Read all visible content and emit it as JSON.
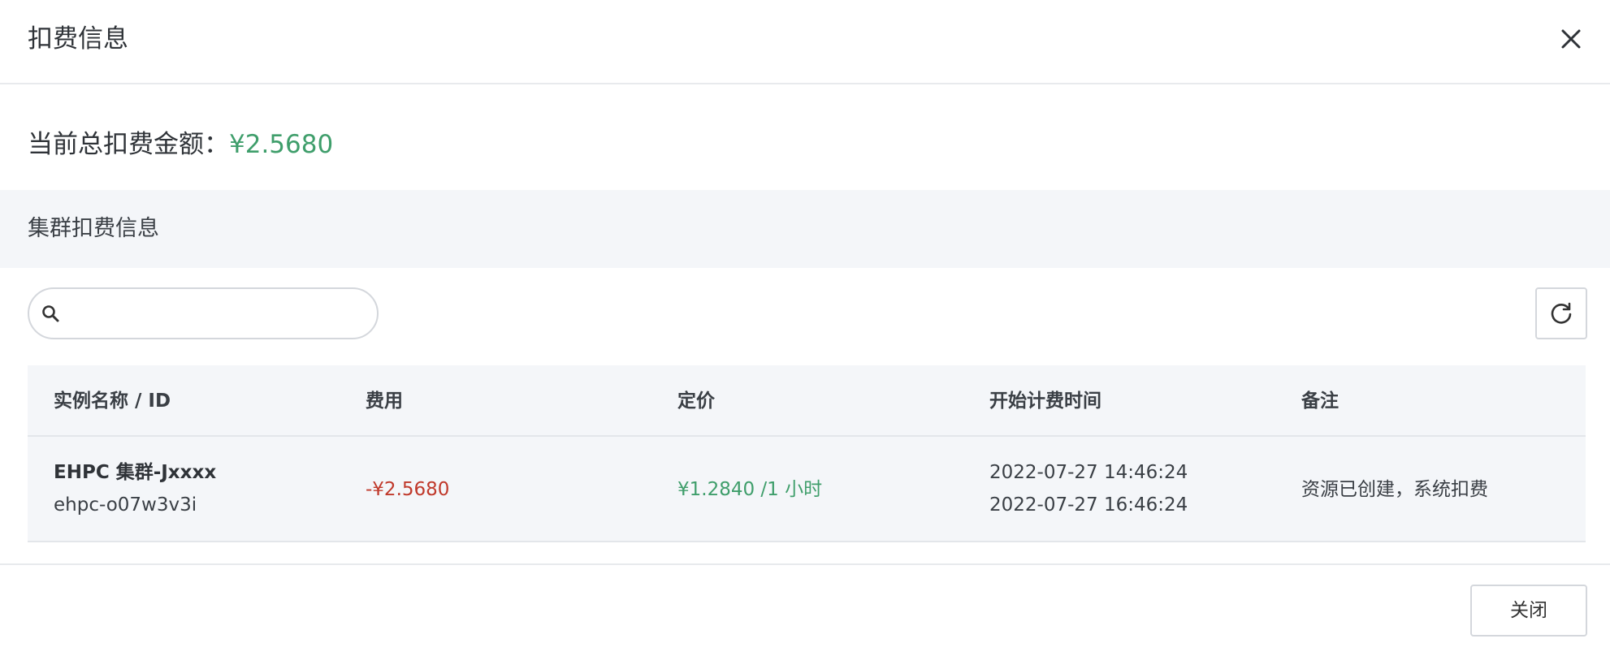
{
  "dialog": {
    "title": "扣费信息",
    "close_icon": "close-icon"
  },
  "summary": {
    "label": "当前总扣费金额：",
    "amount": "¥2.5680",
    "amount_color": "#3f9e6b"
  },
  "section": {
    "title": "集群扣费信息"
  },
  "toolbar": {
    "search_icon": "search-icon",
    "search_value": "",
    "search_placeholder": "",
    "refresh_icon": "refresh-icon"
  },
  "table": {
    "columns": [
      "实例名称 / ID",
      "费用",
      "定价",
      "开始计费时间",
      "备注"
    ],
    "rows": [
      {
        "instance_name": "EHPC 集群-Jxxxx",
        "instance_id": "ehpc-o07w3v3i",
        "cost": "-¥2.5680",
        "price": "¥1.2840 /1 小时",
        "start_time": "2022-07-27 14:46:24",
        "end_time": "2022-07-27 16:46:24",
        "note": "资源已创建，系统扣费"
      }
    ]
  },
  "footer": {
    "close_label": "关闭"
  },
  "colors": {
    "cost_negative": "#c0392b",
    "price_positive": "#3f9e6b",
    "band_bg": "#f4f6f9"
  }
}
